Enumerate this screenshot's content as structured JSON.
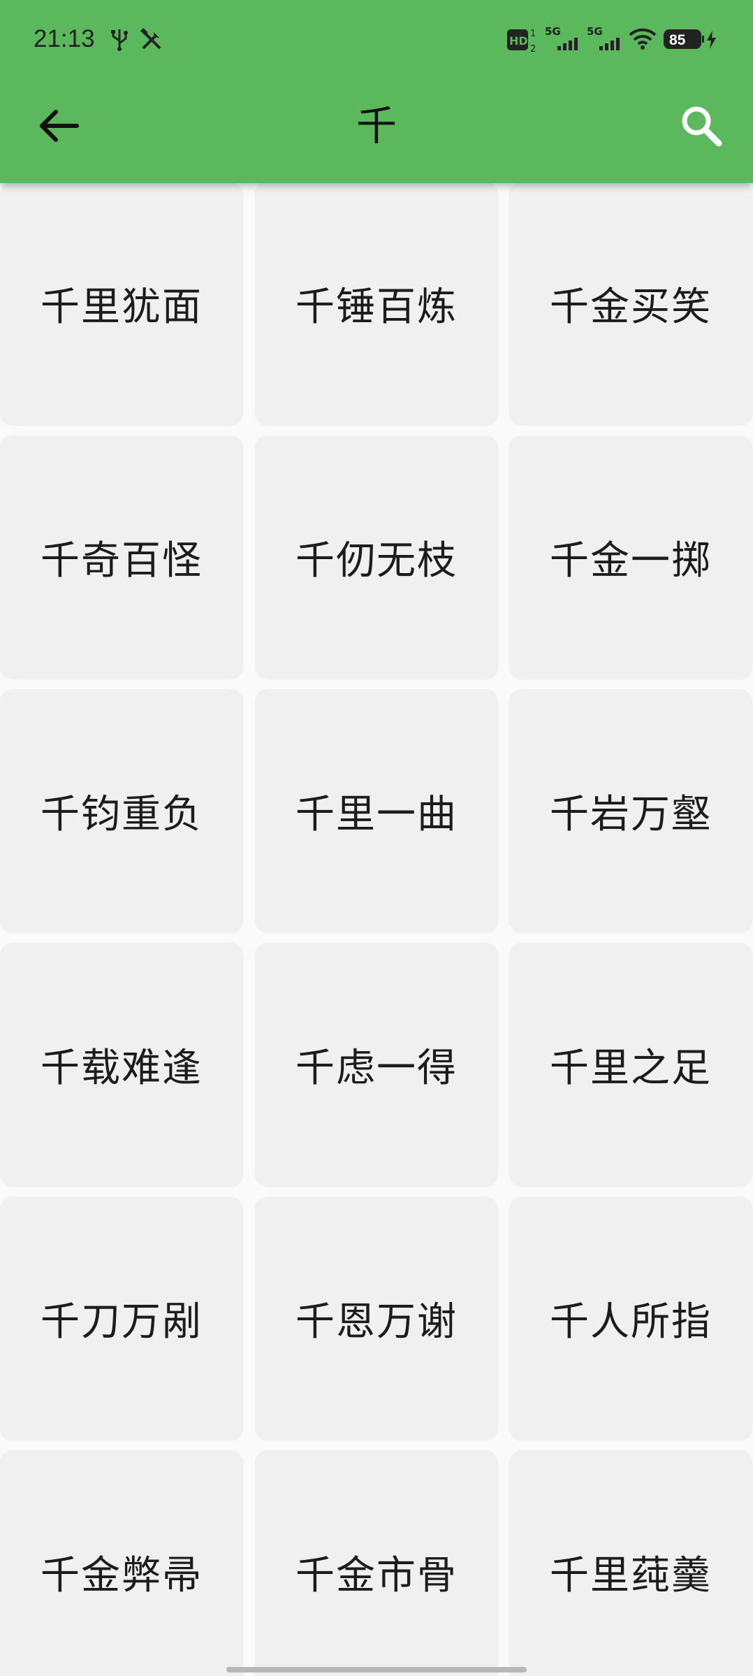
{
  "status_bar": {
    "time": "21:13",
    "left_icons": [
      "usb-icon",
      "tools-icon"
    ],
    "hd_label": "HD",
    "sim1_label": "5G",
    "sim2_label": "5G",
    "battery": "85"
  },
  "toolbar": {
    "title": "千",
    "back_icon": "arrow-left-icon",
    "search_icon": "search-icon"
  },
  "idioms": [
    "千里犹面",
    "千锤百炼",
    "千金买笑",
    "千奇百怪",
    "千仞无枝",
    "千金一掷",
    "千钧重负",
    "千里一曲",
    "千岩万壑",
    "千载难逢",
    "千虑一得",
    "千里之足",
    "千刀万剐",
    "千恩万谢",
    "千人所指",
    "千金弊帚",
    "千金市骨",
    "千里莼羹"
  ],
  "colors": {
    "app_bar": "#5cb85c",
    "cell_bg": "#f0f0f0",
    "page_bg": "#fafafa"
  }
}
